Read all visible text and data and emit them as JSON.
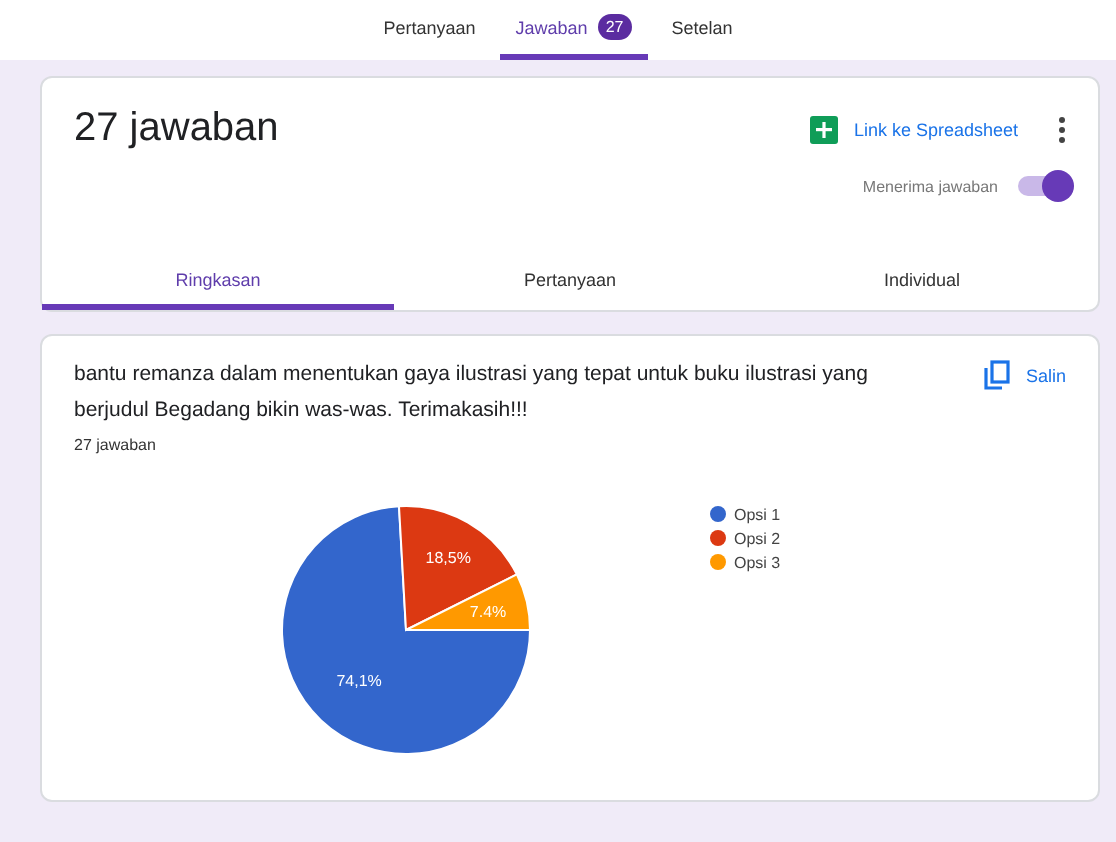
{
  "top_tabs": [
    {
      "label": "Pertanyaan",
      "selected": false
    },
    {
      "label": "Jawaban",
      "selected": true,
      "badge": "27"
    },
    {
      "label": "Setelan",
      "selected": false
    }
  ],
  "header": {
    "title": "27 jawaban",
    "spreadsheet_link": "Link ke Spreadsheet",
    "accepting_label": "Menerima jawaban",
    "accepting_on": true
  },
  "view_tabs": [
    {
      "label": "Ringkasan",
      "selected": true
    },
    {
      "label": "Pertanyaan",
      "selected": false
    },
    {
      "label": "Individual",
      "selected": false
    }
  ],
  "question": {
    "text": "bantu remanza dalam menentukan gaya ilustrasi yang tepat untuk buku ilustrasi yang berjudul Begadang bikin was-was. Terimakasih!!!",
    "copy_label": "Salin",
    "count": "27 jawaban",
    "chart_data": {
      "type": "pie",
      "categories": [
        "Opsi 1",
        "Opsi 2",
        "Opsi 3"
      ],
      "values": [
        74.1,
        18.5,
        7.4
      ],
      "legend": "right",
      "colors": [
        "#3366cc",
        "#dc3912",
        "#ff9900"
      ],
      "value_labels": [
        "74,1%",
        "18,5%",
        "7.4%"
      ]
    }
  }
}
